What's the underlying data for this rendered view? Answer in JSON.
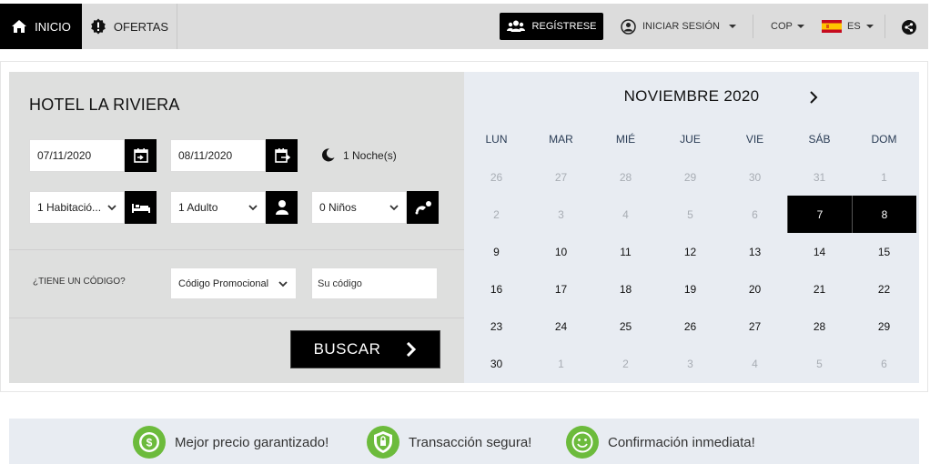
{
  "nav": {
    "home_label": "INICIO",
    "offers_label": "OFERTAS",
    "register_label": "REGÍSTRESE",
    "login_label": "INICIAR SESIÓN",
    "currency": "COP",
    "language": "ES"
  },
  "search": {
    "hotel_name": "HOTEL LA RIVIERA",
    "checkin": "07/11/2020",
    "checkout": "08/11/2020",
    "nights": "1 Noche(s)",
    "rooms": "1 Habitació...",
    "adults": "1 Adulto",
    "children": "0 Niños",
    "code_question": "¿TIENE UN CÓDIGO?",
    "promo_type": "Código Promocional",
    "code_placeholder": "Su código",
    "search_button": "BUSCAR"
  },
  "calendar": {
    "month_title": "NOVIEMBRE 2020",
    "weekdays": [
      "LUN",
      "MAR",
      "MIÉ",
      "JUE",
      "VIE",
      "SÁB",
      "DOM"
    ],
    "weeks": [
      [
        {
          "d": "26",
          "m": true
        },
        {
          "d": "27",
          "m": true
        },
        {
          "d": "28",
          "m": true
        },
        {
          "d": "29",
          "m": true
        },
        {
          "d": "30",
          "m": true
        },
        {
          "d": "31",
          "m": true
        },
        {
          "d": "1",
          "m": true
        }
      ],
      [
        {
          "d": "2",
          "m": true
        },
        {
          "d": "3",
          "m": true
        },
        {
          "d": "4",
          "m": true
        },
        {
          "d": "5",
          "m": true
        },
        {
          "d": "6",
          "m": true
        },
        {
          "d": "7",
          "s": true
        },
        {
          "d": "8",
          "s": true
        }
      ],
      [
        {
          "d": "9"
        },
        {
          "d": "10"
        },
        {
          "d": "11"
        },
        {
          "d": "12"
        },
        {
          "d": "13"
        },
        {
          "d": "14"
        },
        {
          "d": "15"
        }
      ],
      [
        {
          "d": "16"
        },
        {
          "d": "17"
        },
        {
          "d": "18"
        },
        {
          "d": "19"
        },
        {
          "d": "20"
        },
        {
          "d": "21"
        },
        {
          "d": "22"
        }
      ],
      [
        {
          "d": "23"
        },
        {
          "d": "24"
        },
        {
          "d": "25"
        },
        {
          "d": "26"
        },
        {
          "d": "27"
        },
        {
          "d": "28"
        },
        {
          "d": "29"
        }
      ],
      [
        {
          "d": "30"
        },
        {
          "d": "1",
          "m": true
        },
        {
          "d": "2",
          "m": true
        },
        {
          "d": "3",
          "m": true
        },
        {
          "d": "4",
          "m": true
        },
        {
          "d": "5",
          "m": true
        },
        {
          "d": "6",
          "m": true
        }
      ]
    ]
  },
  "features": [
    {
      "label": "Mejor precio garantizado!",
      "icon": "money-badge-icon"
    },
    {
      "label": "Transacción segura!",
      "icon": "shield-lock-icon"
    },
    {
      "label": "Confirmación inmediata!",
      "icon": "smiley-icon"
    }
  ],
  "colors": {
    "accent": "#000000",
    "panel_bg": "#dedfde",
    "calendar_bg": "#e8ecf2",
    "feature_green": "#6cbb3c"
  }
}
